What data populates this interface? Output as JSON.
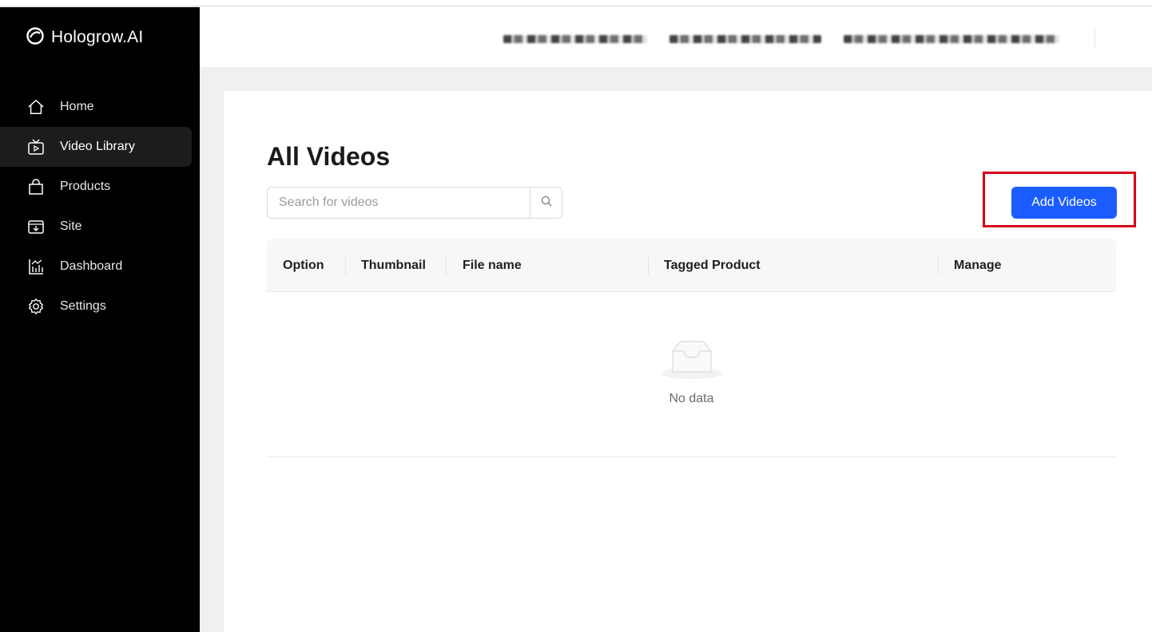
{
  "brand": {
    "name": "Hologrow.AI"
  },
  "sidebar": {
    "items": [
      {
        "label": "Home",
        "icon": "home-icon"
      },
      {
        "label": "Video Library",
        "icon": "tv-play-icon",
        "active": true
      },
      {
        "label": "Products",
        "icon": "shopping-bag-icon"
      },
      {
        "label": "Site",
        "icon": "site-download-icon"
      },
      {
        "label": "Dashboard",
        "icon": "bar-chart-icon"
      },
      {
        "label": "Settings",
        "icon": "gear-icon"
      }
    ]
  },
  "main": {
    "title": "All Videos",
    "search": {
      "placeholder": "Search for videos",
      "value": ""
    },
    "add_button_label": "Add Videos",
    "table": {
      "columns": [
        "Option",
        "Thumbnail",
        "File name",
        "Tagged Product",
        "Manage"
      ],
      "rows": [],
      "empty_text": "No data"
    }
  },
  "colors": {
    "sidebar_bg": "#000000",
    "primary": "#1a5cff",
    "highlight": "#d4001a",
    "canvas_bg": "#f0f0f0"
  }
}
